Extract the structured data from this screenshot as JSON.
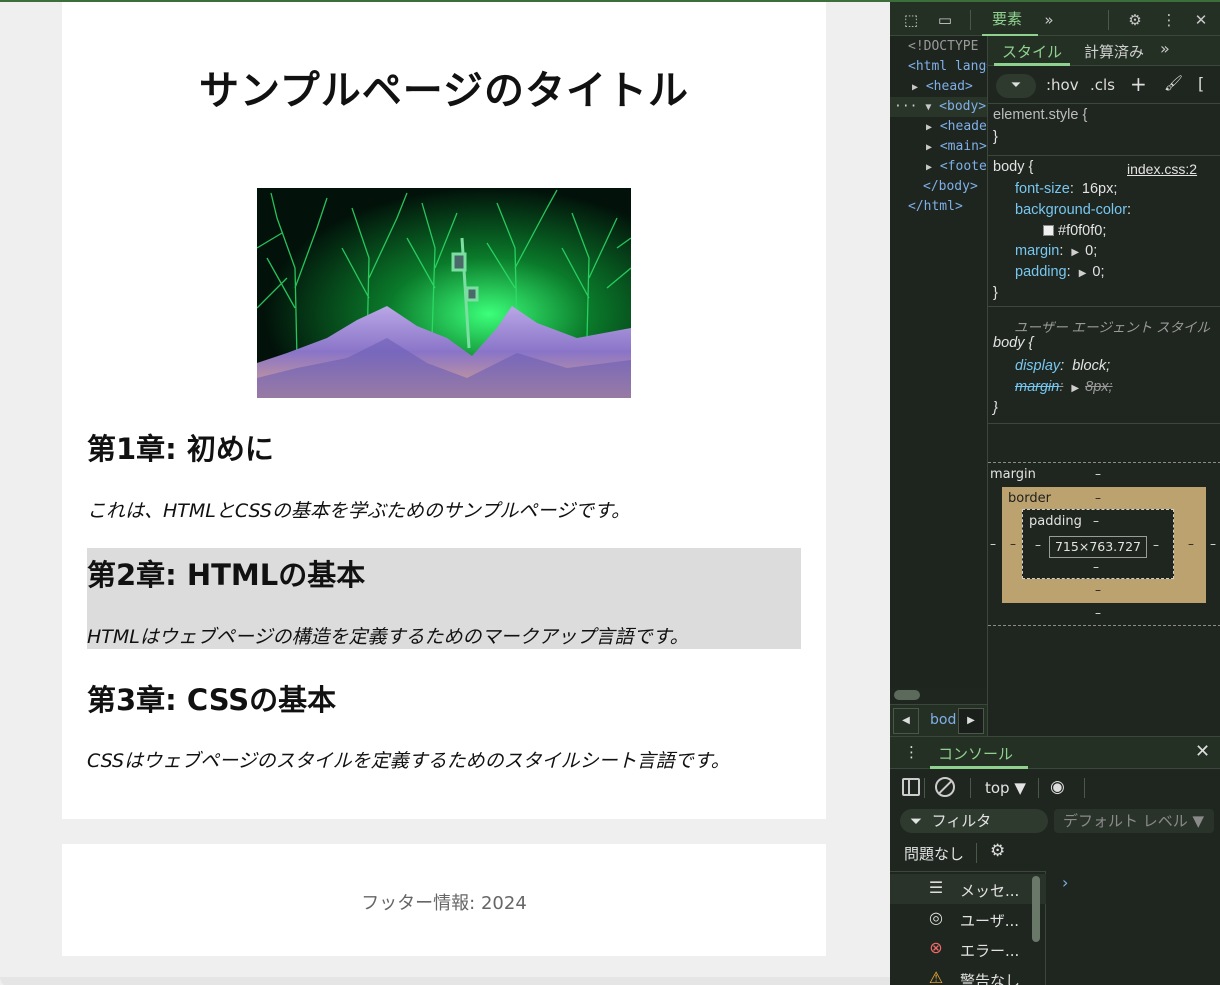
{
  "page": {
    "title": "サンプルページのタイトル",
    "chapters": [
      {
        "heading": "第1章: 初めに",
        "text": "これは、HTMLとCSSの基本を学ぶためのサンプルページです。"
      },
      {
        "heading": "第2章: HTMLの基本",
        "text": "HTMLはウェブページの構造を定義するためのマークアップ言語です。"
      },
      {
        "heading": "第3章: CSSの基本",
        "text": "CSSはウェブページのスタイルを定義するためのスタイルシート言語です。"
      }
    ],
    "footer": "フッター情報: 2024"
  },
  "devtools": {
    "tab_elements": "要素",
    "more_tabs": "»",
    "dom": {
      "doctype": "<!DOCTYPE",
      "html": "<html lang=",
      "head": "<head>",
      "body": "<body> =",
      "header": "<header",
      "main": "<main>",
      "footer": "<footer",
      "body_close": "</body>",
      "html_close": "</html>",
      "dots": "…",
      "ellipsis_badge": "···"
    },
    "breadcrumb": "bod",
    "styles": {
      "tab_style": "スタイル",
      "tab_computed": "計算済み",
      "tab_more": "»",
      "hov": ":hov",
      "cls": ".cls",
      "element_style_selector": "element.style {",
      "close_brace": "}",
      "body_rule": {
        "selector": "body {",
        "source": "index.css:2",
        "props": [
          {
            "name": "font-size",
            "value": "16px;"
          },
          {
            "name": "background-color",
            "value": ""
          },
          {
            "name": "",
            "value": "#f0f0f0;"
          },
          {
            "name": "margin",
            "value": "0;"
          },
          {
            "name": "padding",
            "value": "0;"
          }
        ]
      },
      "ua_rule": {
        "label": "ユーザー エージェント スタイル",
        "selector": "body {",
        "props": [
          {
            "name": "display",
            "value": "block;"
          },
          {
            "name": "margin",
            "value": "8px;"
          }
        ]
      },
      "box_model": {
        "margin": "margin",
        "border": "border",
        "padding": "padding",
        "dash": "–",
        "content": "715×763.727"
      }
    },
    "console": {
      "title": "コンソール",
      "context": "top ▼",
      "filter": "フィルタ",
      "level": "デフォルト レベル ▼",
      "issues": "問題なし",
      "items": [
        {
          "icon": "list-icon",
          "label": "メッセ..."
        },
        {
          "icon": "user-icon",
          "label": "ユーザ..."
        },
        {
          "icon": "error-icon",
          "label": "エラー..."
        },
        {
          "icon": "warning-icon",
          "label": "警告なし"
        }
      ],
      "prompt": "›"
    }
  },
  "colors": {
    "devtools_bg": "#1f251f",
    "accent_green": "#8fd18f",
    "prop_blue": "#77c7f0",
    "box_border": "#bba26f",
    "page_bg": "#f0f0f0"
  }
}
